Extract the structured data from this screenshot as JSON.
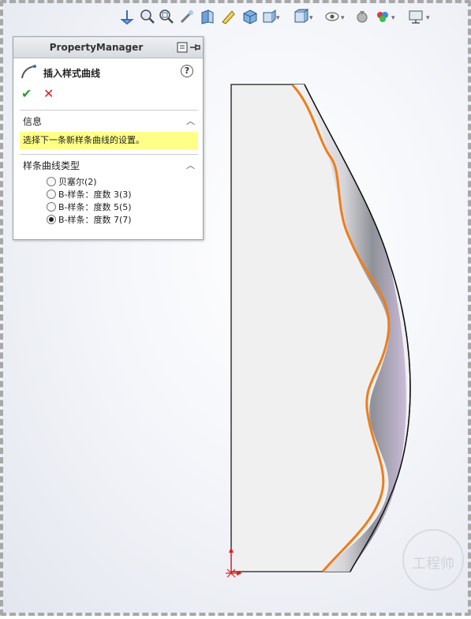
{
  "property_manager": {
    "title": "PropertyManager",
    "feature_title": "插入样式曲线",
    "info_section": {
      "title": "信息",
      "message": "选择下一条新样条曲线的设置。"
    },
    "spline_type_section": {
      "title": "样条曲线类型",
      "options": [
        {
          "label": "贝塞尔(2)",
          "selected": false
        },
        {
          "label": "B-样条：度数 3(3)",
          "selected": false
        },
        {
          "label": "B-样条：度数 5(5)",
          "selected": false
        },
        {
          "label": "B-样条：度数 7(7)",
          "selected": true
        }
      ]
    }
  },
  "toolbar": {
    "icons": [
      "view-normal-icon",
      "zoom-fit-icon",
      "zoom-area-icon",
      "previous-view-icon",
      "section-view-icon",
      "dynamic-annotation-icon",
      "view-orientation-icon",
      "display-style-icon",
      "hide-show-icon",
      "edit-appearance-icon",
      "apply-scene-icon",
      "view-settings-icon",
      "display-icon"
    ]
  },
  "colors": {
    "accent_orange": "#ee7d1a",
    "highlight_yellow": "#ffff88",
    "ok_green": "#2e9b2e",
    "cancel_red": "#d41f1f"
  },
  "watermark": "工程帅"
}
